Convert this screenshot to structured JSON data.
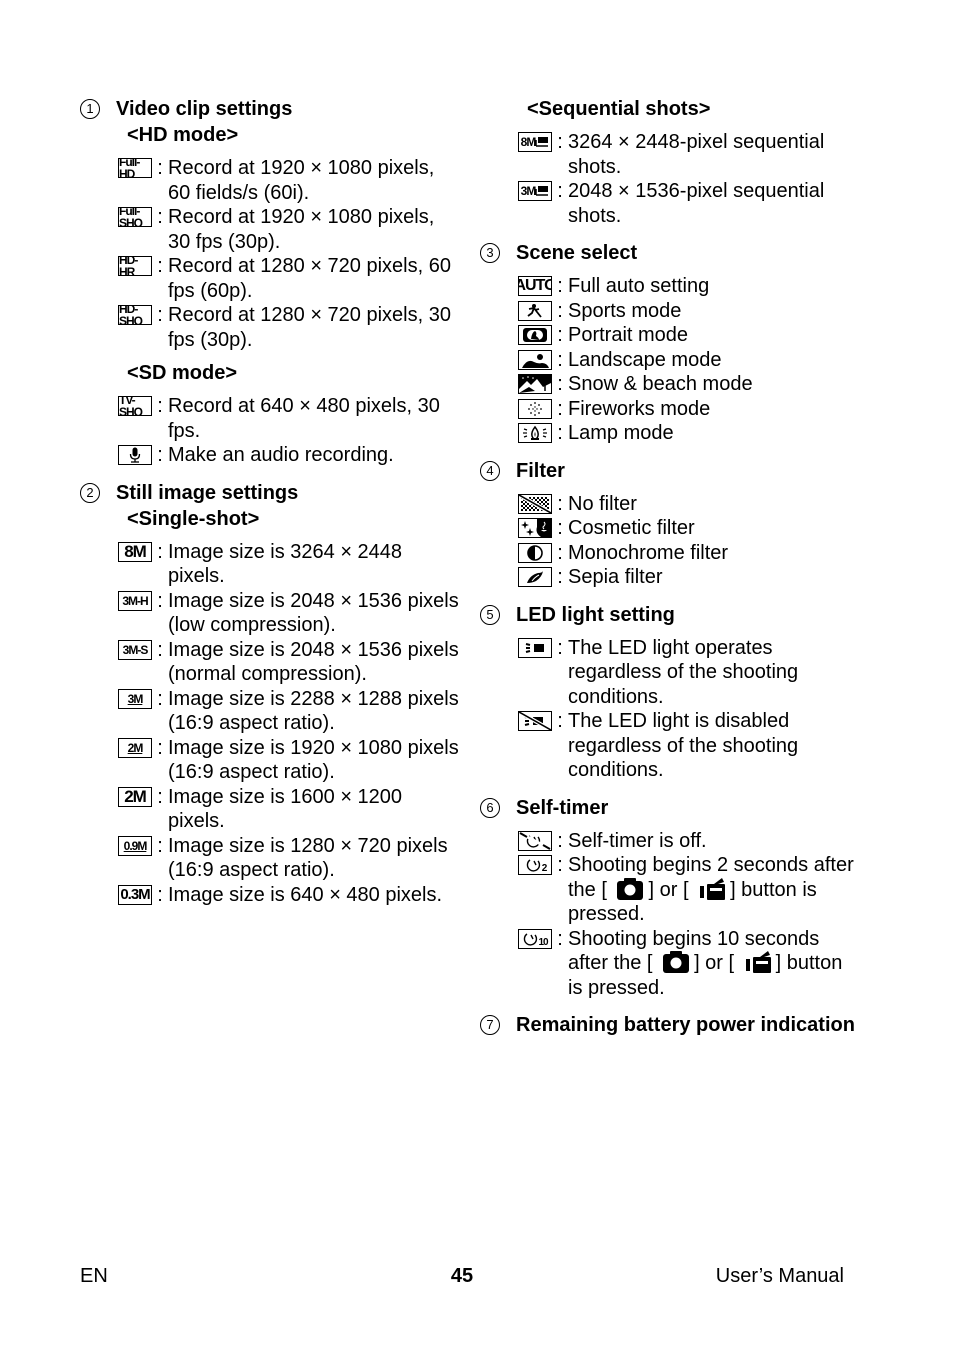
{
  "sections": {
    "video": {
      "number": "1",
      "title": "Video clip settings",
      "hd_mode_label": "<HD mode>",
      "hd_items": [
        {
          "icon": "Full-HD",
          "desc": "Record at 1920 × 1080 pixels, 60 fields/s (60i)."
        },
        {
          "icon": "Full-SHQ",
          "desc": "Record at 1920 × 1080 pixels, 30 fps (30p)."
        },
        {
          "icon": "HD-HR",
          "desc": "Record at 1280 × 720 pixels, 60 fps (60p)."
        },
        {
          "icon": "HD-SHQ",
          "desc": "Record at 1280 × 720 pixels, 30 fps (30p)."
        }
      ],
      "sd_mode_label": "<SD mode>",
      "sd_items": [
        {
          "icon": "TV-SHQ",
          "desc": "Record at 640 × 480 pixels, 30 fps."
        },
        {
          "icon": "microphone-icon",
          "desc": "Make an audio recording."
        }
      ]
    },
    "still": {
      "number": "2",
      "title": "Still image settings",
      "single_label": "<Single-shot>",
      "single_items": [
        {
          "icon": "8M",
          "desc": "Image size is 3264 × 2448 pixels."
        },
        {
          "icon": "3M-H",
          "desc": "Image size is 2048 × 1536 pixels (low compression)."
        },
        {
          "icon": "3M-S",
          "desc": "Image size is 2048 × 1536 pixels (normal compression)."
        },
        {
          "icon": "3M",
          "desc": "Image size is 2288 × 1288 pixels (16:9 aspect ratio)."
        },
        {
          "icon": "2M",
          "desc": "Image size is 1920 × 1080 pixels (16:9 aspect ratio)."
        },
        {
          "icon": "2M",
          "desc": "Image size is 1600 × 1200 pixels."
        },
        {
          "icon": "0.9M",
          "desc": "Image size is 1280 × 720 pixels (16:9 aspect ratio)."
        },
        {
          "icon": "0.3M",
          "desc": "Image size is 640 × 480 pixels."
        }
      ],
      "sequential_label": "<Sequential shots>",
      "sequential_items": [
        {
          "icon": "8M",
          "desc": "3264 × 2448-pixel sequential shots."
        },
        {
          "icon": "3M",
          "desc": "2048 × 1536-pixel sequential shots."
        }
      ]
    },
    "scene": {
      "number": "3",
      "title": "Scene select",
      "items": [
        {
          "icon": "AUTO",
          "desc": "Full auto setting"
        },
        {
          "icon": "sports-icon",
          "desc": "Sports mode"
        },
        {
          "icon": "portrait-icon",
          "desc": "Portrait mode"
        },
        {
          "icon": "landscape-icon",
          "desc": "Landscape mode"
        },
        {
          "icon": "snow-beach-icon",
          "desc": "Snow & beach mode"
        },
        {
          "icon": "fireworks-icon",
          "desc": "Fireworks mode"
        },
        {
          "icon": "lamp-icon",
          "desc": "Lamp mode"
        }
      ]
    },
    "filter": {
      "number": "4",
      "title": "Filter",
      "items": [
        {
          "icon": "no-filter-icon",
          "desc": "No filter"
        },
        {
          "icon": "cosmetic-filter-icon",
          "desc": "Cosmetic filter"
        },
        {
          "icon": "monochrome-filter-icon",
          "desc": "Monochrome filter"
        },
        {
          "icon": "sepia-filter-icon",
          "desc": "Sepia filter"
        }
      ]
    },
    "led": {
      "number": "5",
      "title": "LED light setting",
      "items": [
        {
          "icon": "led-on-icon",
          "desc": "The LED light operates regardless of the shooting conditions."
        },
        {
          "icon": "led-off-icon",
          "desc": "The LED light is disabled regardless of the shooting conditions."
        }
      ]
    },
    "timer": {
      "number": "6",
      "title": "Self-timer",
      "items": [
        {
          "icon": "self-timer-off-icon",
          "desc": "Self-timer is off."
        },
        {
          "icon": "self-timer-2-icon",
          "sub": "2",
          "desc_a": "Shooting begins 2 seconds after the [",
          "desc_b": "] or [",
          "desc_c": "] button is pressed."
        },
        {
          "icon": "self-timer-10-icon",
          "sub": "10",
          "desc_a": "Shooting begins 10 seconds after the [",
          "desc_b": "] or [",
          "desc_c": "] button is pressed."
        }
      ]
    },
    "battery": {
      "number": "7",
      "title": "Remaining battery power indication"
    }
  },
  "colon": ":",
  "footer": {
    "language": "EN",
    "page_number": "45",
    "manual": "User’s Manual"
  }
}
